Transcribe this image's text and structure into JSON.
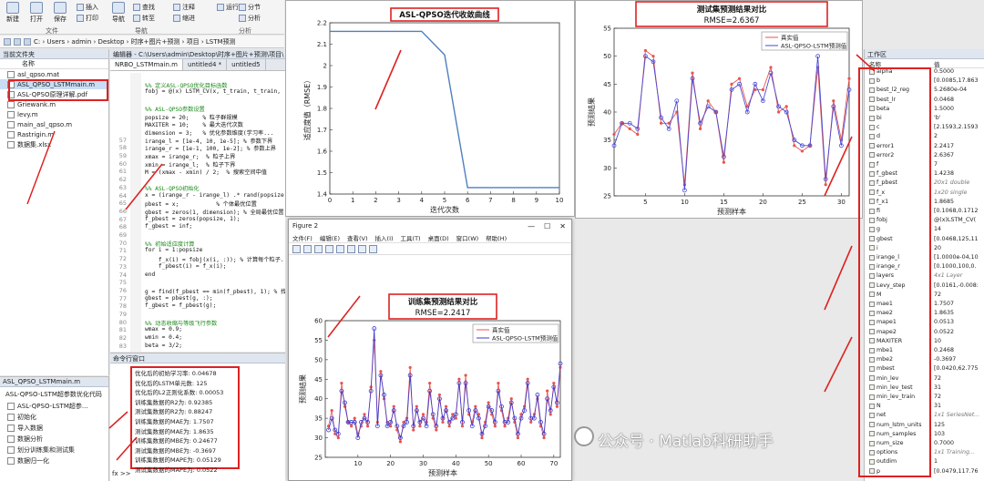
{
  "toolstrip": {
    "buttons": [
      "新建",
      "打开",
      "保存",
      "插入",
      "打印",
      "导航"
    ],
    "small": [
      "查找",
      "转至",
      "注释",
      "缩进",
      "运行",
      "分节",
      "分析"
    ],
    "sections": [
      "文件",
      "导航",
      "分析"
    ]
  },
  "pathbar": {
    "path": "C: › Users › admin › Desktop › 时序+图片+预测 › 项目 › LSTM预测"
  },
  "file_panel": {
    "header": "当前文件夹",
    "column": "名称",
    "files": [
      {
        "name": "asl_qpso.mat",
        "sel": false
      },
      {
        "name": "ASL_QPSO_LSTMmain.m",
        "sel": true
      },
      {
        "name": "ASL-QPSO原理详解.pdf",
        "sel": false
      },
      {
        "name": "Griewank.m",
        "sel": false
      },
      {
        "name": "levy.m",
        "sel": false
      },
      {
        "name": "main_asl_qpso.m",
        "sel": false
      },
      {
        "name": "Rastrigin.m",
        "sel": false
      },
      {
        "name": "数据集.xlsx",
        "sel": false
      }
    ]
  },
  "detail_panel": {
    "file": "ASL_QPSO_LSTMmain.m",
    "title": "ASL-QPSO-LSTM超参数优化代码",
    "items": [
      "ASL-QPSO-LSTM超参...",
      "初始化",
      "导入数据",
      "数据分析",
      "划分训练集和测试集",
      "数据归一化"
    ],
    "prompt": "fx >>"
  },
  "editor": {
    "title": "编辑器 - C:\\Users\\admin\\Desktop\\时序+图片+预测\\项目\\",
    "tabs": [
      "NRBO_LSTMmain.m",
      "untitled4 *",
      "untitled5"
    ],
    "lines": [
      {
        "n": "",
        "t": "",
        "c": false
      },
      {
        "n": "",
        "t": "%% 定义ASL-QPSO优化目标函数",
        "c": true
      },
      {
        "n": "",
        "t": "fobj = @(x) LSTM_CV(x, t_train, t_train, ...",
        "c": false
      },
      {
        "n": "",
        "t": "",
        "c": false
      },
      {
        "n": "",
        "t": "%% ASL-QPSO参数设置",
        "c": true
      },
      {
        "n": "",
        "t": "popsize = 20;    % 粒子群规模",
        "c": false
      },
      {
        "n": "",
        "t": "MAXITER = 10;    % 最大迭代次数",
        "c": false
      },
      {
        "n": "",
        "t": "dimension = 3;   % 优化参数维度(学习率...",
        "c": false
      },
      {
        "n": "57",
        "t": "irange_l = [1e-4, 10, 1e-5]; % 参数下界",
        "c": false
      },
      {
        "n": "58",
        "t": "irange_r = [1e-1, 100, 1e-2]; % 参数上界",
        "c": false
      },
      {
        "n": "59",
        "t": "xmax = irange_r;  % 粒子上界",
        "c": false
      },
      {
        "n": "60",
        "t": "xmin = irange_l;  % 粒子下界",
        "c": false
      },
      {
        "n": "61",
        "t": "M = (xmax - xmin) / 2;  % 搜索空间中值",
        "c": false
      },
      {
        "n": "62",
        "t": "",
        "c": false
      },
      {
        "n": "63",
        "t": "%% ASL-QPSO初始化",
        "c": true
      },
      {
        "n": "64",
        "t": "x = (irange_r - irange_l) .* rand(popsize...",
        "c": false
      },
      {
        "n": "65",
        "t": "pbest = x;           % 个体最优位置",
        "c": false
      },
      {
        "n": "66",
        "t": "gbest = zeros(1, dimension); % 全局最优位置",
        "c": false
      },
      {
        "n": "67",
        "t": "f_pbest = zeros(popsize, 1);",
        "c": false
      },
      {
        "n": "68",
        "t": "f_gbest = inf;",
        "c": false
      },
      {
        "n": "69",
        "t": "",
        "c": false
      },
      {
        "n": "70",
        "t": "%% 初始适应度计算",
        "c": true
      },
      {
        "n": "71",
        "t": "for i = 1:popsize",
        "c": false
      },
      {
        "n": "72",
        "t": "    f_x(i) = fobj(x(i, :)); % 计算每个粒子...",
        "c": false
      },
      {
        "n": "73",
        "t": "    f_pbest(i) = f_x(i);",
        "c": false
      },
      {
        "n": "74",
        "t": "end",
        "c": false
      },
      {
        "n": "75",
        "t": "",
        "c": false
      },
      {
        "n": "76",
        "t": "g = find(f_pbest == min(f_pbest), 1); % 找...",
        "c": false
      },
      {
        "n": "77",
        "t": "gbest = pbest(g, :);",
        "c": false
      },
      {
        "n": "78",
        "t": "f_gbest = f_pbest(g);",
        "c": false
      },
      {
        "n": "79",
        "t": "",
        "c": false
      },
      {
        "n": "80",
        "t": "%% 动态收缩与等级飞行参数",
        "c": true
      },
      {
        "n": "81",
        "t": "wmax = 0.9;",
        "c": false
      },
      {
        "n": "82",
        "t": "wmin = 0.4;",
        "c": false
      },
      {
        "n": "83",
        "t": "beta = 3/2;",
        "c": false
      }
    ]
  },
  "command_window": {
    "title": "命令行窗口",
    "lines": [
      "优化后的初始学习率: 0.04678",
      "优化后的LSTM单元数: 125",
      "优化后的L2正则化系数: 0.00053",
      "训练集数据的R2为: 0.92385",
      "测试集数据的R2为: 0.88247",
      "训练集数据的MAE为: 1.7507",
      "测试集数据的MAE为: 1.8635",
      "训练集数据的MBE为: 0.24677",
      "测试集数据的MBE为: -0.3697",
      "训练集数据的MAPE为: 0.05129",
      "测试集数据的MAPE为: 0.0522"
    ]
  },
  "figure1": {
    "chart_data": {
      "type": "line",
      "title": "ASL-QPSO迭代收敛曲线",
      "xlabel": "迭代次数",
      "ylabel": "适应度值（RMSE）",
      "xlim": [
        0,
        10
      ],
      "ylim": [
        1.4,
        2.2
      ],
      "xticks": [
        0,
        1,
        2,
        3,
        4,
        5,
        6,
        7,
        8,
        9,
        10
      ],
      "yticks": [
        1.4,
        1.5,
        1.6,
        1.7,
        1.8,
        1.9,
        2.0,
        2.1,
        2.2
      ],
      "x": [
        0,
        1,
        2,
        3,
        4,
        5,
        6,
        7,
        8,
        9,
        10
      ],
      "values": [
        2.16,
        2.16,
        2.16,
        2.16,
        2.16,
        2.05,
        1.43,
        1.43,
        1.43,
        1.43,
        1.43
      ],
      "color": "#4f7fc0"
    }
  },
  "figure3": {
    "chart_data": {
      "type": "line",
      "title": "测试集预测结果对比",
      "subtitle": "RMSE=2.6367",
      "xlabel": "预测样本",
      "ylabel": "预测结果",
      "xlim": [
        1,
        31
      ],
      "ylim": [
        25,
        55
      ],
      "xticks": [
        5,
        10,
        15,
        20,
        25,
        30
      ],
      "yticks": [
        25,
        30,
        35,
        40,
        45,
        50,
        55
      ],
      "x": [
        1,
        2,
        3,
        4,
        5,
        6,
        7,
        8,
        9,
        10,
        11,
        12,
        13,
        14,
        15,
        16,
        17,
        18,
        19,
        20,
        21,
        22,
        23,
        24,
        25,
        26,
        27,
        28,
        29,
        30,
        31
      ],
      "series": [
        {
          "name": "真实值",
          "color": "#e8554e",
          "values": [
            36,
            38,
            37,
            36,
            51,
            50,
            38,
            38,
            40,
            27,
            47,
            37,
            42,
            40,
            31,
            45,
            46,
            41,
            44,
            44,
            48,
            40,
            41,
            34,
            33,
            34,
            48,
            27,
            42,
            35,
            46
          ]
        },
        {
          "name": "ASL-QPSO-LSTM预测值",
          "color": "#4a4ad6",
          "values": [
            34,
            38,
            38,
            37,
            50,
            49,
            39,
            37,
            42,
            26,
            46,
            38,
            41,
            40,
            32,
            44,
            45,
            40,
            45,
            42,
            47,
            41,
            40,
            35,
            34,
            34,
            50,
            28,
            41,
            34,
            44
          ]
        }
      ]
    }
  },
  "figure2": {
    "window_title": "Figure 2",
    "menu": [
      "文件(F)",
      "编辑(E)",
      "查看(V)",
      "插入(I)",
      "工具(T)",
      "桌面(D)",
      "窗口(W)",
      "帮助(H)"
    ],
    "chart_data": {
      "type": "line",
      "title": "训练集预测结果对比",
      "subtitle": "RMSE=2.2417",
      "xlabel": "预测样本",
      "ylabel": "预测结果",
      "xlim": [
        0,
        72
      ],
      "ylim": [
        25,
        60
      ],
      "xticks": [
        10,
        20,
        30,
        40,
        50,
        60,
        70
      ],
      "yticks": [
        25,
        30,
        35,
        40,
        45,
        50,
        55,
        60
      ],
      "x": [
        1,
        2,
        3,
        4,
        5,
        6,
        7,
        8,
        9,
        10,
        11,
        12,
        13,
        14,
        15,
        16,
        17,
        18,
        19,
        20,
        21,
        22,
        23,
        24,
        25,
        26,
        27,
        28,
        29,
        30,
        31,
        32,
        33,
        34,
        35,
        36,
        37,
        38,
        39,
        40,
        41,
        42,
        43,
        44,
        45,
        46,
        47,
        48,
        49,
        50,
        51,
        52,
        53,
        54,
        55,
        56,
        57,
        58,
        59,
        60,
        61,
        62,
        63,
        64,
        65,
        66,
        67,
        68,
        69,
        70,
        71,
        72
      ],
      "series": [
        {
          "name": "真实值",
          "color": "#e8554e",
          "values": [
            33,
            37,
            31,
            30,
            44,
            38,
            34,
            33,
            35,
            31,
            33,
            36,
            33,
            43,
            55,
            34,
            47,
            40,
            34,
            33,
            38,
            32,
            29,
            34,
            35,
            48,
            32,
            38,
            33,
            36,
            34,
            44,
            35,
            32,
            41,
            34,
            38,
            33,
            36,
            35,
            45,
            33,
            46,
            36,
            34,
            38,
            36,
            30,
            34,
            39,
            36,
            33,
            44,
            37,
            33,
            35,
            40,
            34,
            30,
            36,
            38,
            45,
            34,
            36,
            40,
            33,
            30,
            42,
            36,
            44,
            38,
            48
          ]
        },
        {
          "name": "ASL-QPSO-LSTM预测值",
          "color": "#3a3ad0",
          "values": [
            32,
            35,
            32,
            31,
            42,
            39,
            34,
            34,
            34,
            30,
            34,
            35,
            34,
            42,
            58,
            33,
            46,
            41,
            33,
            34,
            37,
            33,
            30,
            33,
            34,
            46,
            33,
            37,
            34,
            35,
            33,
            42,
            36,
            33,
            40,
            35,
            37,
            34,
            35,
            36,
            44,
            34,
            44,
            37,
            33,
            37,
            35,
            31,
            33,
            38,
            37,
            34,
            42,
            38,
            34,
            34,
            39,
            35,
            31,
            35,
            37,
            44,
            35,
            35,
            41,
            34,
            31,
            40,
            37,
            43,
            39,
            49
          ]
        }
      ]
    }
  },
  "workspace": {
    "header": "工作区",
    "col_name": "名称",
    "col_value": "值",
    "rows": [
      {
        "name": "alpha",
        "value": "0.5000",
        "it": false
      },
      {
        "name": "b",
        "value": "[0.0085,17.863",
        "it": false
      },
      {
        "name": "best_l2_reg",
        "value": "5.2680e-04",
        "it": false
      },
      {
        "name": "best_lr",
        "value": "0.0468",
        "it": false
      },
      {
        "name": "beta",
        "value": "1.5000",
        "it": false
      },
      {
        "name": "bi",
        "value": "'b'",
        "it": false
      },
      {
        "name": "c",
        "value": "[2.1593,2.1593",
        "it": false
      },
      {
        "name": "d",
        "value": "2",
        "it": false
      },
      {
        "name": "error1",
        "value": "2.2417",
        "it": false
      },
      {
        "name": "error2",
        "value": "2.6367",
        "it": false
      },
      {
        "name": "f",
        "value": "7",
        "it": false
      },
      {
        "name": "f_gbest",
        "value": "1.4238",
        "it": false
      },
      {
        "name": "f_pbest",
        "value": "20x1 double",
        "it": true
      },
      {
        "name": "f_x",
        "value": "1x20 single",
        "it": true
      },
      {
        "name": "f_x1",
        "value": "1.8685",
        "it": false
      },
      {
        "name": "fi",
        "value": "[0.1068,0.1712",
        "it": false
      },
      {
        "name": "fobj",
        "value": "@(x)LSTM_CV(",
        "it": false
      },
      {
        "name": "g",
        "value": "14",
        "it": false
      },
      {
        "name": "gbest",
        "value": "[0.0468,125,11",
        "it": false
      },
      {
        "name": "i",
        "value": "20",
        "it": false
      },
      {
        "name": "irange_l",
        "value": "[1.0000e-04,10",
        "it": false
      },
      {
        "name": "irange_r",
        "value": "[0.1000,100,0.",
        "it": false
      },
      {
        "name": "layers",
        "value": "4x1 Layer",
        "it": true
      },
      {
        "name": "Levy_step",
        "value": "[0.0161,-0.008:",
        "it": false
      },
      {
        "name": "M",
        "value": "72",
        "it": false
      },
      {
        "name": "mae1",
        "value": "1.7507",
        "it": false
      },
      {
        "name": "mae2",
        "value": "1.8635",
        "it": false
      },
      {
        "name": "mape1",
        "value": "0.0513",
        "it": false
      },
      {
        "name": "mape2",
        "value": "0.0522",
        "it": false
      },
      {
        "name": "MAXITER",
        "value": "10",
        "it": false
      },
      {
        "name": "mbe1",
        "value": "0.2468",
        "it": false
      },
      {
        "name": "mbe2",
        "value": "-0.3697",
        "it": false
      },
      {
        "name": "mbest",
        "value": "[0.0420,62.775",
        "it": false
      },
      {
        "name": "min_lev",
        "value": "72",
        "it": false
      },
      {
        "name": "min_lev_test",
        "value": "31",
        "it": false
      },
      {
        "name": "min_lev_train",
        "value": "72",
        "it": false
      },
      {
        "name": "N",
        "value": "31",
        "it": false
      },
      {
        "name": "net",
        "value": "1x1 SeriesNet...",
        "it": true
      },
      {
        "name": "num_lstm_units",
        "value": "125",
        "it": false
      },
      {
        "name": "num_samples",
        "value": "103",
        "it": false
      },
      {
        "name": "num_size",
        "value": "0.7000",
        "it": false
      },
      {
        "name": "options",
        "value": "1x1 Training...",
        "it": true
      },
      {
        "name": "outdim",
        "value": "1",
        "it": false
      },
      {
        "name": "p",
        "value": "[0.0479,117.76",
        "it": false
      }
    ]
  },
  "watermark": "公众号 · Matlab科研助手"
}
